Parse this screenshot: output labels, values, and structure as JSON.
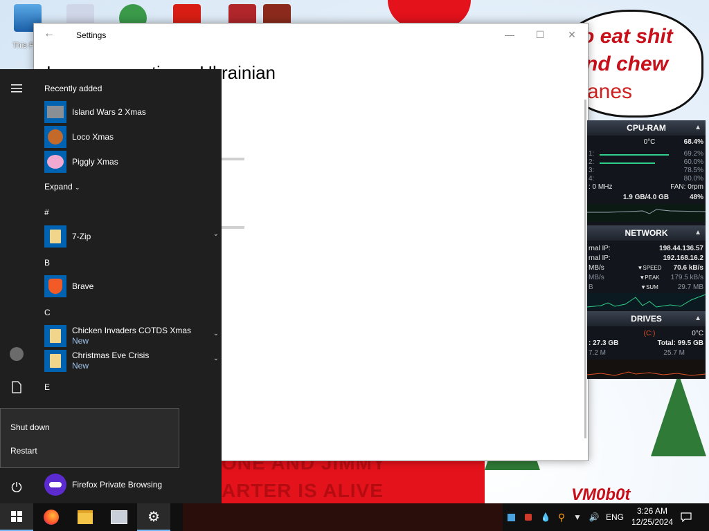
{
  "desktop": {
    "icon_label": "This P",
    "bubble_lines": [
      "o eat shit",
      "nd chew",
      "anes"
    ],
    "bottom_lines": [
      "ONE AND JIMMY",
      "ARTER IS ALIVE"
    ],
    "signature": "VM0b0t"
  },
  "settings_window": {
    "title": "Settings",
    "back_icon": "back-arrow-icon",
    "heading": "Language options: Ukrainian",
    "controls": {
      "minimize": "—",
      "maximize": "☐",
      "close": "✕"
    }
  },
  "gadget": {
    "cpu": {
      "header": "CPU-RAM",
      "temp": "0°C",
      "total": "68.4%",
      "cores": [
        {
          "label": "1:",
          "value": "69.2%",
          "fill": 0.692
        },
        {
          "label": "2:",
          "value": "60.0%",
          "fill": 0.6
        },
        {
          "label": "3:",
          "value": "78.5%",
          "fill": 0.785
        },
        {
          "label": "4:",
          "value": "80.0%",
          "fill": 0.8
        }
      ],
      "freq": ": 0 MHz",
      "fan": "FAN: 0rpm",
      "ram": "1.9 GB/4.0 GB",
      "ram_pct": "48%"
    },
    "network": {
      "header": "NETWORK",
      "external_label": "rnal IP:",
      "external_ip": "198.44.136.57",
      "internal_label": "rnal IP:",
      "internal_ip": "192.168.16.2",
      "speed_left": "MB/s",
      "speed_label": "SPEED",
      "speed": "70.6 kB/s",
      "peak_left": "MB/s",
      "peak_label": "PEAK",
      "peak": "179.5 kB/s",
      "sum_left": "B",
      "sum_label": "SUM",
      "sum": "29.7 MB"
    },
    "drives": {
      "header": "DRIVES",
      "drive": "(C:)",
      "temp": "0°C",
      "free": ": 27.3 GB",
      "total": "Total: 99.5 GB",
      "read": "7.2 M",
      "write": "25.7 M"
    },
    "colors": {
      "bar_green": "#2fd08a",
      "bar_teal": "#27c4c0",
      "header": "#2b3340"
    }
  },
  "start_menu": {
    "recently_added": "Recently added",
    "recent_apps": [
      {
        "name": "Island Wars 2 Xmas",
        "icon": "island-wars-icon"
      },
      {
        "name": "Loco Xmas",
        "icon": "loco-icon"
      },
      {
        "name": "Piggly Xmas",
        "icon": "piggly-icon"
      }
    ],
    "expand": "Expand",
    "sections": [
      {
        "letter": "#",
        "apps": [
          {
            "name": "7-Zip",
            "sub": "",
            "icon": "folder-icon"
          }
        ]
      },
      {
        "letter": "B",
        "apps": [
          {
            "name": "Brave",
            "sub": "",
            "icon": "brave-icon"
          }
        ]
      },
      {
        "letter": "C",
        "apps": [
          {
            "name": "Chicken Invaders COTDS Xmas",
            "sub": "New",
            "icon": "folder-icon"
          },
          {
            "name": "Christmas Eve Crisis",
            "sub": "New",
            "icon": "folder-icon"
          }
        ]
      },
      {
        "letter": "E",
        "apps": []
      }
    ],
    "last_app": "Firefox Private Browsing",
    "power_menu": {
      "shut_down": "Shut down",
      "restart": "Restart"
    }
  },
  "taskbar": {
    "language": "ENG",
    "time": "3:26 AM",
    "date": "12/25/2024"
  }
}
